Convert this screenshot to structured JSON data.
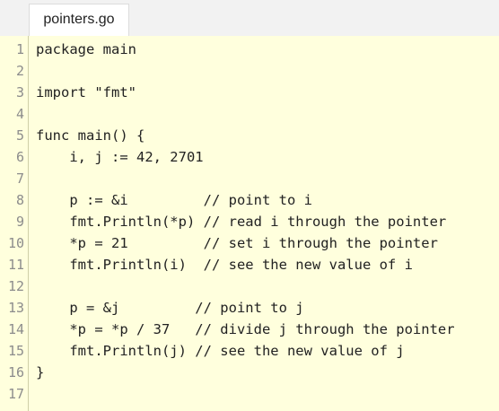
{
  "tab": {
    "filename": "pointers.go"
  },
  "editor": {
    "lines": [
      {
        "number": "1",
        "text": "package main"
      },
      {
        "number": "2",
        "text": ""
      },
      {
        "number": "3",
        "text": "import \"fmt\""
      },
      {
        "number": "4",
        "text": ""
      },
      {
        "number": "5",
        "text": "func main() {"
      },
      {
        "number": "6",
        "text": "    i, j := 42, 2701"
      },
      {
        "number": "7",
        "text": ""
      },
      {
        "number": "8",
        "text": "    p := &i         // point to i"
      },
      {
        "number": "9",
        "text": "    fmt.Println(*p) // read i through the pointer"
      },
      {
        "number": "10",
        "text": "    *p = 21         // set i through the pointer"
      },
      {
        "number": "11",
        "text": "    fmt.Println(i)  // see the new value of i"
      },
      {
        "number": "12",
        "text": ""
      },
      {
        "number": "13",
        "text": "    p = &j         // point to j"
      },
      {
        "number": "14",
        "text": "    *p = *p / 37   // divide j through the pointer"
      },
      {
        "number": "15",
        "text": "    fmt.Println(j) // see the new value of j"
      },
      {
        "number": "16",
        "text": "}"
      },
      {
        "number": "17",
        "text": ""
      }
    ]
  },
  "colors": {
    "editor_background": "#ffffdd",
    "gutter_border": "#cfcfa8",
    "line_number": "#8c8c8c",
    "code_text": "#222222"
  }
}
